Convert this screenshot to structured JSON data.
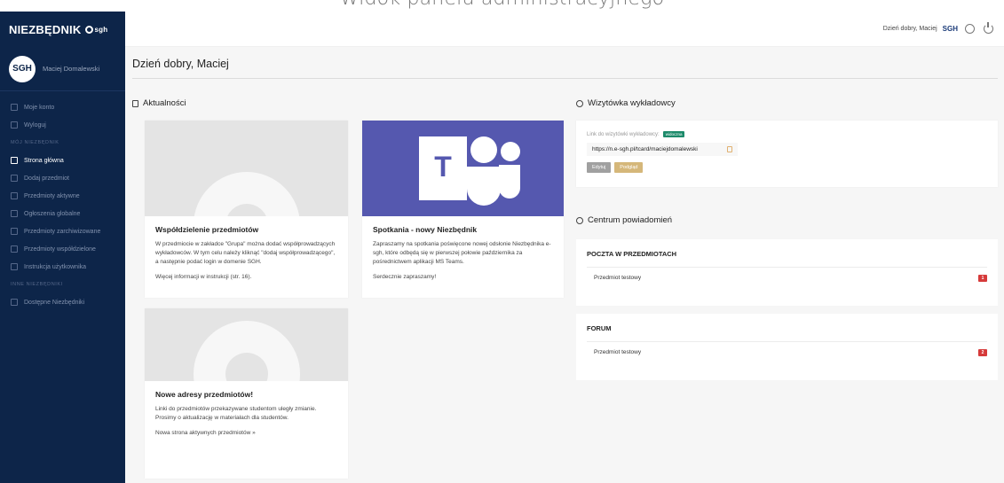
{
  "page_caption": "Widok panelu administracyjnego",
  "brand": {
    "name": "NIEZBĘDNIK",
    "sgh": "sgh"
  },
  "user": {
    "avatar": "SGH",
    "name": "Maciej Domalewski"
  },
  "sidebar": {
    "account_items": [
      {
        "label": "Moje konto",
        "icon": "user-icon"
      },
      {
        "label": "Wyloguj",
        "icon": "logout-icon"
      }
    ],
    "section_main": "MÓJ NIEZBĘDNIK",
    "main_items": [
      {
        "label": "Strona główna",
        "icon": "home-icon",
        "active": true
      },
      {
        "label": "Dodaj przedmiot",
        "icon": "add-icon"
      },
      {
        "label": "Przedmioty aktywne",
        "icon": "list-icon"
      },
      {
        "label": "Ogłoszenia globalne",
        "icon": "announcement-icon"
      },
      {
        "label": "Przedmioty zarchiwizowane",
        "icon": "archive-icon"
      },
      {
        "label": "Przedmioty współdzielone",
        "icon": "share-icon"
      },
      {
        "label": "Instrukcja użytkownika",
        "icon": "info-icon"
      }
    ],
    "section_other": "INNE NIEZBĘDNIKI",
    "other_items": [
      {
        "label": "Dostępne Niezbędniki",
        "icon": "list-icon"
      }
    ]
  },
  "topbar": {
    "greeting": "Dzień dobry, Maciej",
    "sgh": "SGH"
  },
  "main": {
    "greeting": "Dzień dobry, Maciej",
    "news_title": "Aktualności",
    "news": [
      {
        "title": "Współdzielenie przedmiotów",
        "text": "W przedmiocie w zakładce \"Grupa\" można dodać współprowadzących wykładowców. W tym celu należy kliknąć \"dodaj współprowadzącego\", a następnie podać login w domenie SGH.",
        "link": "Więcej informacji w instrukcji (str. 16)."
      },
      {
        "title": "Spotkania - nowy Niezbędnik",
        "text": "Zapraszamy na spotkania poświęcone nowej odsłonie Niezbędnika e-sgh, które odbędą się w pierwszej połowie października za pośrednictwem aplikacji MS Teams.",
        "link": "Serdecznie zapraszamy!"
      },
      {
        "title": "Nowe adresy przedmiotów!",
        "text": "Linki do przedmiotów przekazywane studentom uległy zmianie. Prosimy o aktualizację w materiałach dla studentów.",
        "link": "Nowa strona aktywnych przedmiotów »"
      }
    ],
    "card_title": "Wizytówka wykładowcy",
    "card_label": "Link do wizytówki wykładowcy:",
    "card_badge": "widoczna",
    "card_url": "https://n.e-sgh.pl/tcard/maciejdomalewski",
    "card_edit": "Edytuj",
    "card_preview": "Podgląd",
    "notifications_title": "Centrum powiadomień",
    "mail_title": "POCZTA W PRZEDMIOTACH",
    "mail_item": "Przedmiot testowy",
    "mail_count": "1",
    "forum_title": "FORUM",
    "forum_item": "Przedmiot testowy",
    "forum_count": "2"
  }
}
